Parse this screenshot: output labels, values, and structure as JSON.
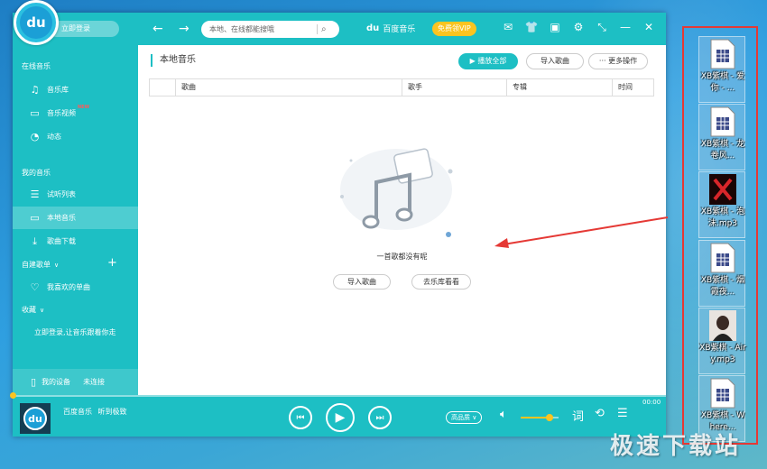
{
  "titlebar": {
    "login_label": "立即登录",
    "search_placeholder": "本地、在线都能搜哦",
    "brand_mark": "du",
    "brand_name": "百度音乐",
    "vip_label": "免费领VIP"
  },
  "logo": {
    "text": "du"
  },
  "sidebar": {
    "section_online": "在线音乐",
    "online_items": [
      {
        "label": "音乐库"
      },
      {
        "label": "音乐视频",
        "badge": "NEW"
      },
      {
        "label": "动态"
      }
    ],
    "section_mine": "我的音乐",
    "mine_items": [
      {
        "label": "试听列表"
      },
      {
        "label": "本地音乐"
      },
      {
        "label": "歌曲下载"
      }
    ],
    "section_playlist": "自建歌单",
    "playlist_items": [
      {
        "label": "我喜欢的单曲"
      }
    ],
    "section_fav": "收藏",
    "fav_hint": "立即登录,让音乐跟着你走",
    "device_label": "我的设备",
    "device_status": "未连接"
  },
  "main": {
    "title": "本地音乐",
    "play_all": "播放全部",
    "import_songs": "导入歌曲",
    "more_ops": "更多操作",
    "columns": [
      "歌曲",
      "歌手",
      "专辑",
      "时间"
    ],
    "empty_text": "一首歌都没有呢",
    "empty_import": "导入歌曲",
    "empty_library": "去乐库看看"
  },
  "player": {
    "cover_text": "du",
    "song_title": "百度音乐",
    "song_subtitle": "听到极致",
    "time": "00:00",
    "quality": "高品质",
    "lyrics_icon_text": "词",
    "volume": 0.75
  },
  "desktop": {
    "items": [
      {
        "label": "XB紫棋 - 爱你 - ...",
        "icon": "audio-file-icon"
      },
      {
        "label": "XB紫棋 - 龙卷风...",
        "icon": "audio-file-icon"
      },
      {
        "label": "XB紫棋 - 泡沫.mp3",
        "icon": "album-red-icon"
      },
      {
        "label": "XB紫棋 - 烟霞夜...",
        "icon": "audio-file-icon"
      },
      {
        "label": "XB紫棋 - Airy.mp3",
        "icon": "album-photo-icon"
      },
      {
        "label": "XB紫棋 - Where...",
        "icon": "audio-file-icon"
      }
    ],
    "watermark": "极速下载站"
  },
  "colors": {
    "accent": "#1dbfc4",
    "vip": "#fbc420",
    "annotation": "#e53935"
  }
}
